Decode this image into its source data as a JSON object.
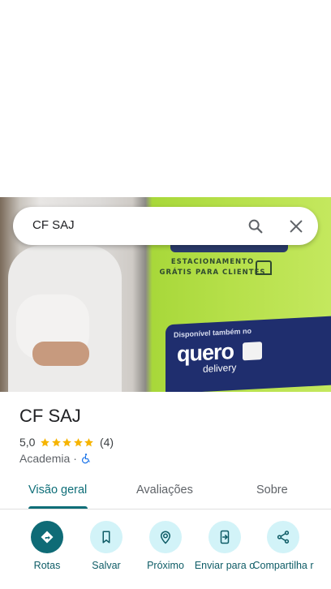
{
  "search": {
    "query": "CF SAJ"
  },
  "hero_photo": {
    "sign_text": "ESTACIONAMENTO GRÁTIS PARA CLIENTES",
    "banner_small": "Disponível também no",
    "banner_brand": "quero",
    "banner_sub": "delivery"
  },
  "place": {
    "name": "CF SAJ",
    "rating": "5,0",
    "stars": 5,
    "review_count": "(4)",
    "category": "Academia",
    "separator": "·"
  },
  "tabs": [
    {
      "label": "Visão geral",
      "active": true
    },
    {
      "label": "Avaliações",
      "active": false
    },
    {
      "label": "Sobre",
      "active": false
    }
  ],
  "actions": [
    {
      "label": "Rotas",
      "icon": "directions-icon"
    },
    {
      "label": "Salvar",
      "icon": "bookmark-icon"
    },
    {
      "label": "Próximo",
      "icon": "nearby-icon"
    },
    {
      "label": "Enviar para o",
      "icon": "send-to-phone-icon"
    },
    {
      "label": "Compartilha r",
      "icon": "share-icon"
    }
  ],
  "colors": {
    "accent": "#0e6e78",
    "action_bg": "#d2f3f8",
    "star": "#f6b400"
  }
}
